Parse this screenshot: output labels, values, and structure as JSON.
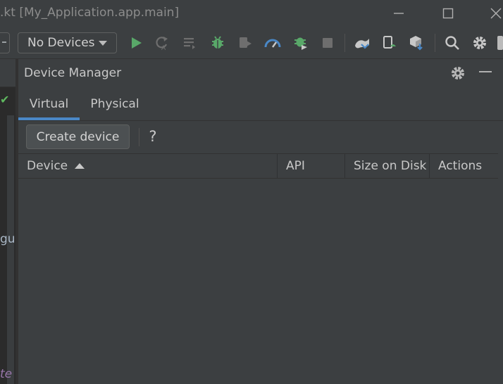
{
  "window": {
    "title": ".kt [My_Application.app.main]"
  },
  "toolbar": {
    "device_select": "No Devices",
    "icons": [
      "run-icon",
      "apply-changes-icon",
      "run-config-icon",
      "debug-icon",
      "attach-icon",
      "profile-icon",
      "debug-attach-icon",
      "stop-icon",
      "sync-gradle-icon",
      "device-mirror-icon",
      "sdk-manager-icon",
      "search-icon",
      "settings-icon"
    ]
  },
  "editor_fragments": {
    "line1": "gu",
    "line2": "te"
  },
  "panel": {
    "title": "Device Manager",
    "tabs": [
      {
        "label": "Virtual",
        "selected": true
      },
      {
        "label": "Physical",
        "selected": false
      }
    ],
    "create_button": "Create device",
    "help": "?",
    "table": {
      "columns": [
        "Device",
        "API",
        "Size on Disk",
        "Actions"
      ],
      "sort_column": "Device",
      "sort_direction": "ascending",
      "rows": []
    }
  },
  "colors": {
    "background": "#2b2b2b",
    "panel": "#3c3f41",
    "accent": "#4a88c7",
    "run_green": "#59a869",
    "text": "#c8c8c8"
  }
}
